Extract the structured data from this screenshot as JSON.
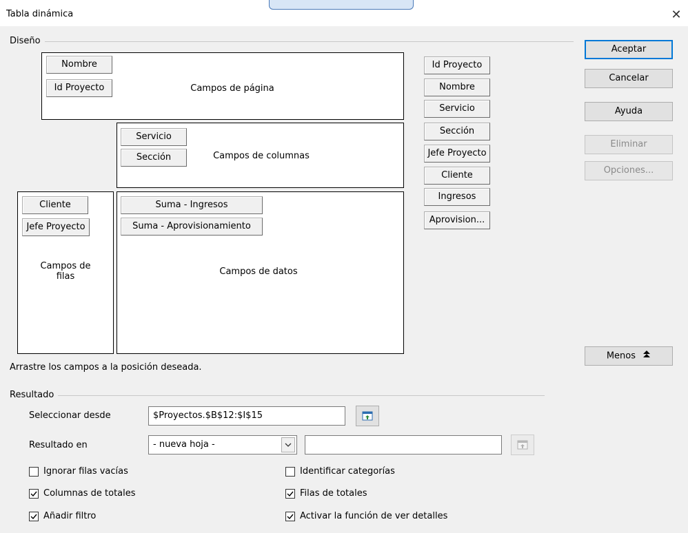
{
  "window": {
    "title": "Tabla dinámica",
    "close_glyph": "✕"
  },
  "design": {
    "group_label": "Diseño",
    "page_fields": [
      "Nombre",
      "Id Proyecto"
    ],
    "page_area_label": "Campos de página",
    "column_fields": [
      "Servicio",
      "Sección"
    ],
    "column_area_label": "Campos de columnas",
    "row_fields": [
      "Cliente",
      "Jefe Proyecto"
    ],
    "row_area_label_line1": "Campos de",
    "row_area_label_line2": "filas",
    "data_fields": [
      "Suma - Ingresos",
      "Suma - Aprovisionamiento"
    ],
    "data_area_label": "Campos de datos",
    "available_fields": [
      "Id Proyecto",
      "Nombre",
      "Servicio",
      "Sección",
      "Jefe Proyecto",
      "Cliente",
      "Ingresos",
      "Aprovision..."
    ],
    "hint": "Arrastre los campos a la posición deseada."
  },
  "buttons": {
    "ok": "Aceptar",
    "cancel": "Cancelar",
    "help": "Ayuda",
    "delete": "Eliminar",
    "options": "Opciones...",
    "less": "Menos",
    "less_icon": "double-chevron-up-icon"
  },
  "result": {
    "group_label": "Resultado",
    "select_from_label": "Seleccionar desde",
    "select_from_value": "$Proyectos.$B$12:$I$15",
    "result_in_label": "Resultado en",
    "result_in_value": "- nueva hoja -",
    "result_in_target": "",
    "shrink_icon": "shrink-range-icon"
  },
  "options": {
    "ignore_empty_rows": {
      "label": "Ignorar filas vacías",
      "checked": false
    },
    "identify_categories": {
      "label": "Identificar categorías",
      "checked": false
    },
    "column_totals": {
      "label": "Columnas de totales",
      "checked": true
    },
    "row_totals": {
      "label": "Filas de totales",
      "checked": true
    },
    "add_filter": {
      "label": "Añadir filtro",
      "checked": true
    },
    "drill_down": {
      "label": "Activar la función de ver detalles",
      "checked": true
    }
  },
  "colors": {
    "accent": "#0078d7",
    "background": "#f0f0f0",
    "box_border": "#000000"
  }
}
